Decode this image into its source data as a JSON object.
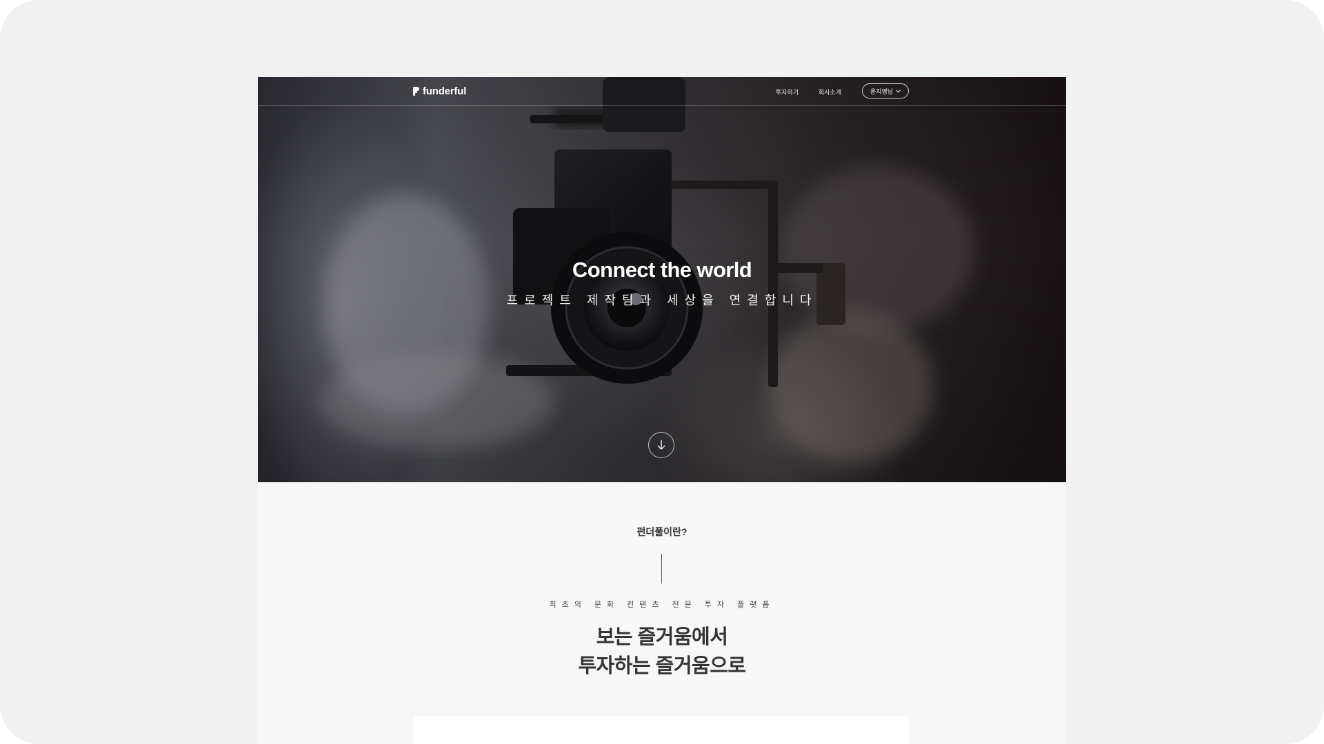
{
  "nav": {
    "logo_text": "funderful",
    "links": [
      {
        "label": "투자하기"
      },
      {
        "label": "회사소개"
      }
    ],
    "user_menu": {
      "label": "운지영님",
      "icon": "chevron-down-icon"
    }
  },
  "hero": {
    "title": "Connect the world",
    "subtitle": "프로젝트 제작팀과 세상을 연결합니다",
    "scroll_icon": "arrow-down-icon"
  },
  "intro": {
    "label": "펀더풀이란?",
    "tagline": "최초의 문화 컨텐츠 전문 투자 플랫폼",
    "heading_line1": "보는 즐거움에서",
    "heading_line2": "투자하는 즐거움으로"
  }
}
